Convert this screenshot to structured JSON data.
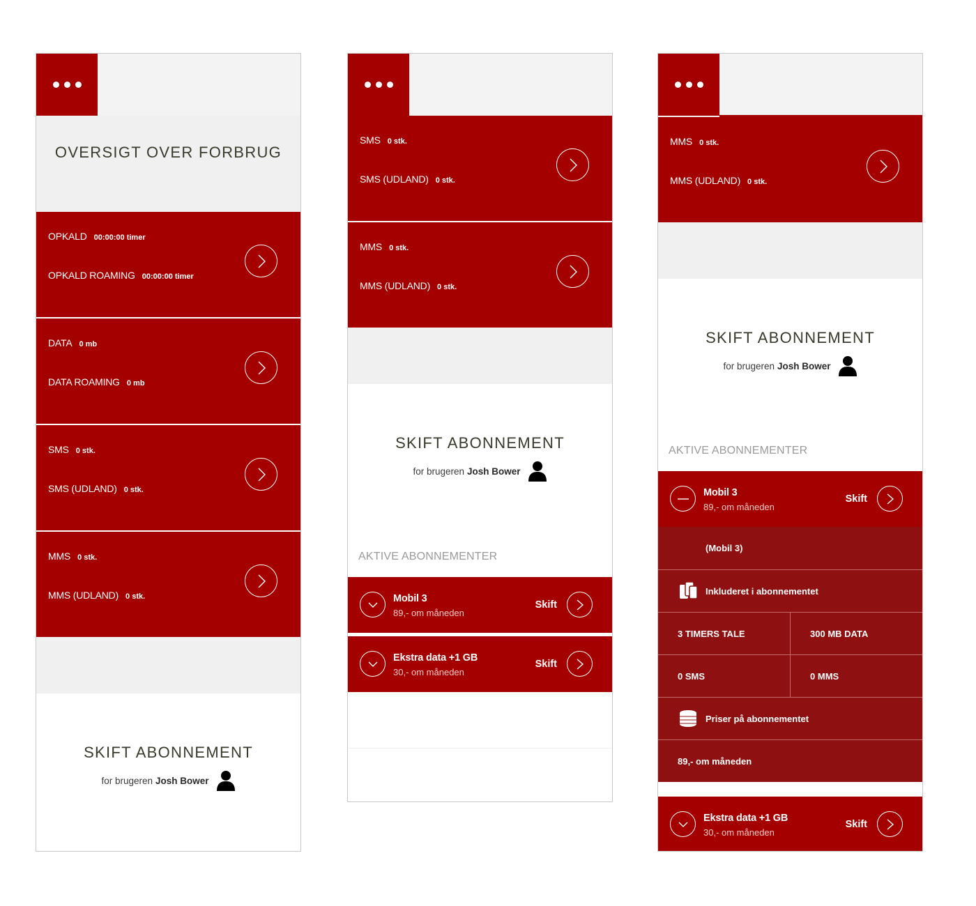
{
  "s1": {
    "title": "OVERSIGT OVER FORBRUG",
    "usage": [
      {
        "label1": "OPKALD",
        "value1": "00:00:00 timer",
        "label2": "OPKALD ROAMING",
        "value2": "00:00:00 timer"
      },
      {
        "label1": "DATA",
        "value1": "0 mb",
        "label2": "DATA ROAMING",
        "value2": "0 mb"
      },
      {
        "label1": "SMS",
        "value1": "0 stk.",
        "label2": "SMS (UDLAND)",
        "value2": "0 stk."
      },
      {
        "label1": "MMS",
        "value1": "0 stk.",
        "label2": "MMS (UDLAND)",
        "value2": "0 stk."
      }
    ],
    "skift": {
      "title": "SKIFT ABONNEMENT",
      "for_text": "for brugeren",
      "user": "Josh Bower"
    }
  },
  "s2": {
    "usage": [
      {
        "label1": "SMS",
        "value1": "0 stk.",
        "label2": "SMS (UDLAND)",
        "value2": "0 stk."
      },
      {
        "label1": "MMS",
        "value1": "0 stk.",
        "label2": "MMS (UDLAND)",
        "value2": "0 stk."
      }
    ],
    "skift": {
      "title": "SKIFT ABONNEMENT",
      "for_text": "for brugeren",
      "user": "Josh Bower"
    },
    "active_label": "AKTIVE ABONNEMENTER",
    "subs": [
      {
        "name": "Mobil 3",
        "price": "89,- om måneden",
        "action": "Skift"
      },
      {
        "name": "Ekstra data +1 GB",
        "price": "30,- om måneden",
        "action": "Skift"
      }
    ]
  },
  "s3": {
    "usage": [
      {
        "label1": "MMS",
        "value1": "0 stk.",
        "label2": "MMS (UDLAND)",
        "value2": "0 stk."
      }
    ],
    "skift": {
      "title": "SKIFT ABONNEMENT",
      "for_text": "for brugeren",
      "user": "Josh Bower"
    },
    "active_label": "AKTIVE ABONNEMENTER",
    "subs": [
      {
        "name": "Mobil 3",
        "price": "89,- om måneden",
        "action": "Skift"
      },
      {
        "name": "Ekstra data +1 GB",
        "price": "30,- om måneden",
        "action": "Skift"
      }
    ],
    "details": {
      "plan_name": "(Mobil 3)",
      "included_title": "Inkluderet i abonnementet",
      "tale_num": "3",
      "tale_unit": "TIMERS TALE",
      "data_num": "300",
      "data_unit": "MB DATA",
      "sms_num": "0",
      "sms_unit": "SMS",
      "mms_num": "0",
      "mms_unit": "MMS",
      "prices_title": "Priser på abonnementet",
      "price_line": "89,- om måneden"
    }
  },
  "colors": {
    "brand_red": "#a50000",
    "detail_red": "#8f1010",
    "light_gray": "#f0f0f0"
  }
}
